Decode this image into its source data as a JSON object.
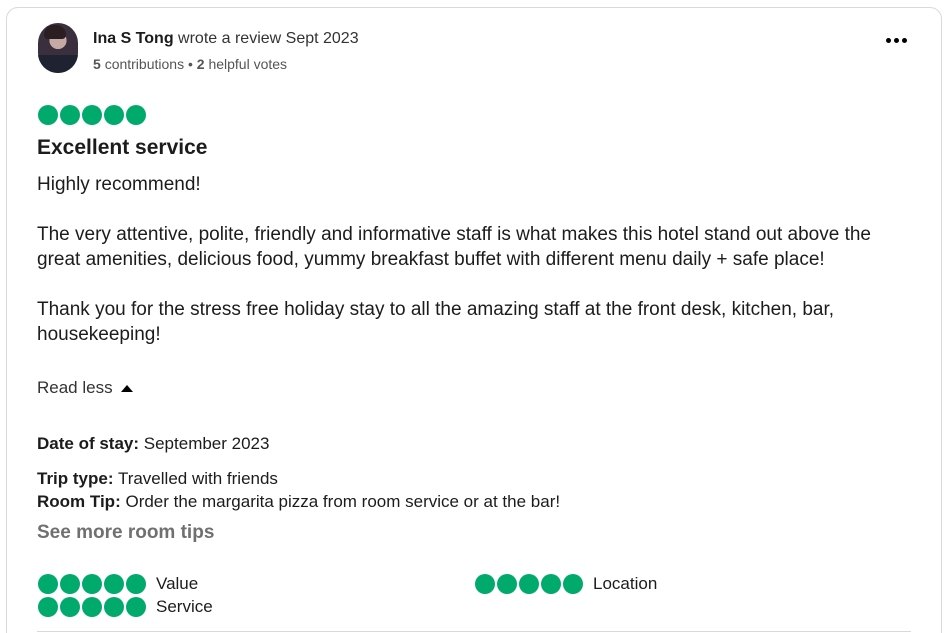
{
  "reviewer": {
    "name": "Ina S Tong",
    "action": "wrote a review Sept 2023",
    "contributions_count": "5",
    "contributions_label": "contributions",
    "separator": "•",
    "helpful_count": "2",
    "helpful_label": "helpful votes"
  },
  "review": {
    "rating": 5,
    "title": "Excellent service",
    "paragraphs": [
      "Highly recommend!",
      "The very attentive, polite, friendly and informative staff is what makes this hotel stand out above the great amenities, delicious food, yummy breakfast buffet with different menu daily + safe place!",
      "Thank you for the stress free holiday stay to all the amazing staff at the front desk, kitchen, bar, housekeeping!"
    ],
    "read_less_label": "Read less"
  },
  "details": {
    "date_of_stay_label": "Date of stay:",
    "date_of_stay_value": "September 2023",
    "trip_type_label": "Trip type:",
    "trip_type_value": "Travelled with friends",
    "room_tip_label": "Room Tip:",
    "room_tip_value": "Order the margarita pizza from room service or at the bar!",
    "see_more_label": "See more room tips"
  },
  "sub_ratings": [
    {
      "label": "Value",
      "rating": 5
    },
    {
      "label": "Location",
      "rating": 5
    },
    {
      "label": "Service",
      "rating": 5
    }
  ],
  "colors": {
    "bubble": "#00aa6c",
    "muted_text": "#707070",
    "border": "#d9d9d9"
  },
  "icons": {
    "menu": "more-horizontal-icon",
    "caret": "caret-up-icon"
  }
}
